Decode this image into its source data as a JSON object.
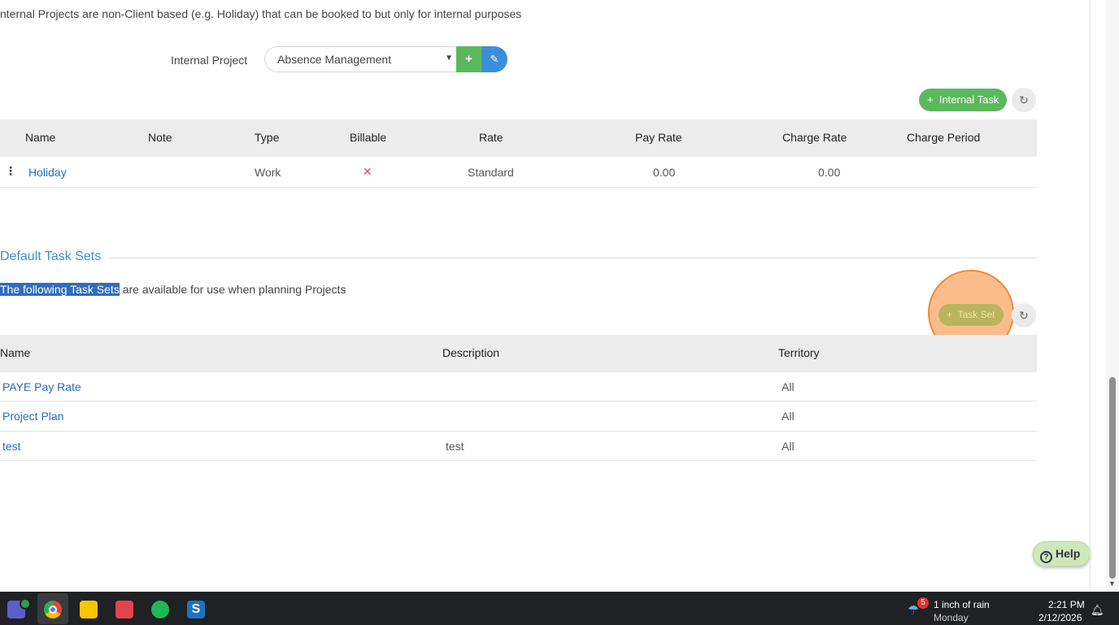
{
  "intro_text": "nternal Projects are non-Client based (e.g. Holiday) that can be booked to but only for internal purposes",
  "internal_project": {
    "label": "Internal Project",
    "selected": "Absence Management"
  },
  "internal_task_button": "Internal Task",
  "tasks_table": {
    "headers": [
      "Name",
      "Note",
      "Type",
      "Billable",
      "Rate",
      "Pay Rate",
      "Charge Rate",
      "Charge Period"
    ],
    "rows": [
      {
        "name": "Holiday",
        "note": "",
        "type": "Work",
        "billable": "✕",
        "rate": "Standard",
        "pay_rate": "0.00",
        "charge_rate": "0.00",
        "charge_period": ""
      }
    ]
  },
  "task_sets": {
    "title": "Default Task Sets",
    "desc_highlight": "The following Task Sets",
    "desc_rest": " are available for use when planning Projects",
    "button": "Task Set",
    "headers": [
      "Name",
      "Description",
      "Territory"
    ],
    "rows": [
      {
        "name": "PAYE Pay Rate",
        "description": "",
        "territory": "All"
      },
      {
        "name": "Project Plan",
        "description": "",
        "territory": "All"
      },
      {
        "name": "test",
        "description": "test",
        "territory": "All"
      }
    ]
  },
  "help_label": "Help",
  "taskbar": {
    "weather_badge": "5",
    "weather_line1": "1 inch of rain",
    "weather_line2": "Monday",
    "time": "2:21 PM",
    "date": "2/12/2026"
  },
  "colors": {
    "green": "#5cb85c",
    "blue": "#3b8fd9",
    "link": "#2a6db1",
    "highlight": "#2f6cc0",
    "focus_ring": "#f08a3a"
  }
}
